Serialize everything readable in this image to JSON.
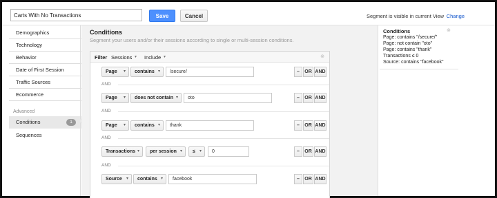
{
  "header": {
    "segment_name": "Carts With No Transactions",
    "save_label": "Save",
    "cancel_label": "Cancel",
    "visibility_text": "Segment is visible in current View",
    "change_label": "Change"
  },
  "sidebar": {
    "items": [
      "Demographics",
      "Technology",
      "Behavior",
      "Date of First Session",
      "Traffic Sources",
      "Ecommerce"
    ],
    "advanced_heading": "Advanced",
    "advanced_items": [
      {
        "label": "Conditions",
        "badge": "1"
      },
      {
        "label": "Sequences"
      }
    ]
  },
  "main": {
    "title": "Conditions",
    "subtitle": "Segment your users and/or their sessions according to single or multi-session conditions.",
    "filter_bar": {
      "filter_label": "Filter",
      "scope": "Sessions",
      "mode": "Include"
    },
    "and_label": "AND",
    "rows": [
      {
        "dimension": "Page",
        "operator": "contains",
        "value": "/secure/"
      },
      {
        "dimension": "Page",
        "operator": "does not contain",
        "value": "oto"
      },
      {
        "dimension": "Page",
        "operator": "contains",
        "value": "thank"
      },
      {
        "dimension": "Transactions",
        "operator": "per session",
        "comparator": "≤",
        "value": "0"
      },
      {
        "dimension": "Source",
        "operator": "contains",
        "value": "facebook"
      }
    ],
    "row_buttons": {
      "minus": "–",
      "or": "OR",
      "and": "AND"
    }
  },
  "summary": {
    "title": "Conditions",
    "lines": [
      "Page: contains \"/secure/\"",
      "Page: not contain \"oto\"",
      "Page: contains \"thank\"",
      "Transactions ≤ 0",
      "Source: contains \"facebook\""
    ]
  },
  "icons": {
    "close": "close-icon",
    "caret": "caret-down-icon"
  },
  "colors": {
    "primary": "#4d90fe",
    "link": "#1155cc",
    "panel_bg": "#f2f2f2"
  }
}
